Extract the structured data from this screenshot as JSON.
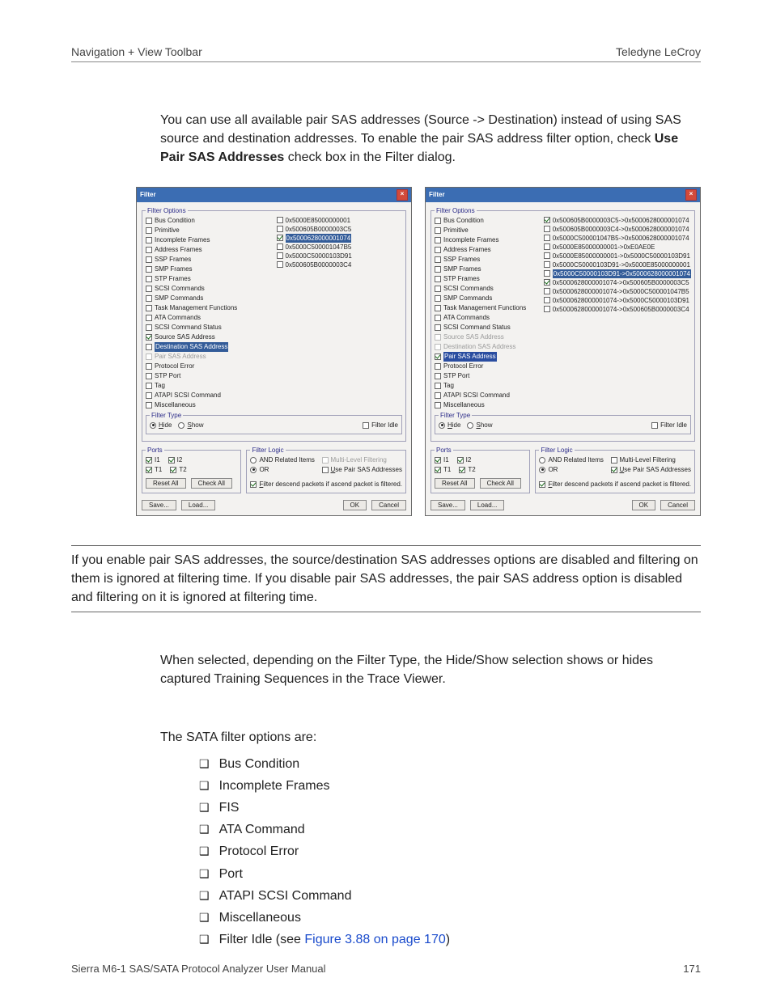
{
  "header": {
    "left": "Navigation + View Toolbar",
    "right": "Teledyne LeCroy"
  },
  "intro": {
    "part1": "You can use all available pair SAS addresses (Source -> Destination) instead of using SAS source and destination addresses. To enable the pair SAS address filter option, check ",
    "bold": "Use Pair SAS Addresses",
    "part2": " check box in the Filter dialog."
  },
  "dlg_labels": {
    "title": "Filter",
    "filter_options": "Filter Options",
    "filter_type": "Filter Type",
    "hide": "Hide",
    "show": "Show",
    "filter_idle": "Filter Idle",
    "ports": "Ports",
    "filter_logic": "Filter Logic",
    "and": "AND Related Items",
    "or": "OR",
    "mlf": "Multi-Level Filtering",
    "use_pair": "Use Pair SAS Addresses",
    "reset": "Reset All",
    "checkall": "Check All",
    "descend": "Filter descend packets if ascend packet is filtered.",
    "save": "Save...",
    "load": "Load...",
    "ok": "OK",
    "cancel": "Cancel",
    "i1": "I1",
    "i2": "I2",
    "t1": "T1",
    "t2": "T2"
  },
  "filter_items": [
    "Bus Condition",
    "Primitive",
    "Incomplete Frames",
    "Address Frames",
    "SSP Frames",
    "SMP Frames",
    "STP Frames",
    "SCSI Commands",
    "SMP Commands",
    "Task Management Functions",
    "ATA Commands",
    "SCSI Command Status",
    "Source SAS Address",
    "Destination SAS Address",
    "Pair SAS Address",
    "Protocol Error",
    "STP Port",
    "Tag",
    "ATAPI SCSI Command",
    "Miscellaneous"
  ],
  "addresses_single": [
    "0x5000E85000000001",
    "0x500605B0000003C5",
    "0x5000628000001074",
    "0x5000C500001047B5",
    "0x5000C50000103D91",
    "0x500605B0000003C4"
  ],
  "addresses_pair": [
    "0x500605B0000003C5->0x5000628000001074",
    "0x500605B0000003C4->0x5000628000001074",
    "0x5000C500001047B5->0x5000628000001074",
    "0x5000E85000000001->0xE0AE0E",
    "0x5000E85000000001->0x5000C50000103D91",
    "0x5000C50000103D91->0x5000E85000000001",
    "0x5000C50000103D91->0x5000628000001074",
    "0x5000628000001074->0x500605B0000003C5",
    "0x5000628000001074->0x5000C500001047B5",
    "0x5000628000001074->0x5000C50000103D91",
    "0x5000628000001074->0x500605B0000003C4"
  ],
  "note": "If you enable pair SAS addresses, the source/destination SAS addresses options are disabled and filtering on them is ignored at filtering time. If you disable pair SAS addresses, the pair SAS address option is disabled and filtering on it is ignored at filtering time.",
  "hide_show_text": "When selected, depending on the Filter Type, the Hide/Show selection shows or hides captured Training Sequences in the Trace Viewer.",
  "sata_intro": "The SATA filter options are:",
  "sata_items": [
    "Bus Condition",
    "Incomplete Frames",
    "FIS",
    "ATA Command",
    "Protocol Error",
    "Port",
    "ATAPI SCSI Command",
    "Miscellaneous"
  ],
  "sata_last": {
    "text": "Filter Idle (see ",
    "link": "Figure 3.88 on page 170",
    "after": ")"
  },
  "footer": {
    "left": "Sierra M6-1 SAS/SATA Protocol Analyzer User Manual",
    "right": "171"
  }
}
